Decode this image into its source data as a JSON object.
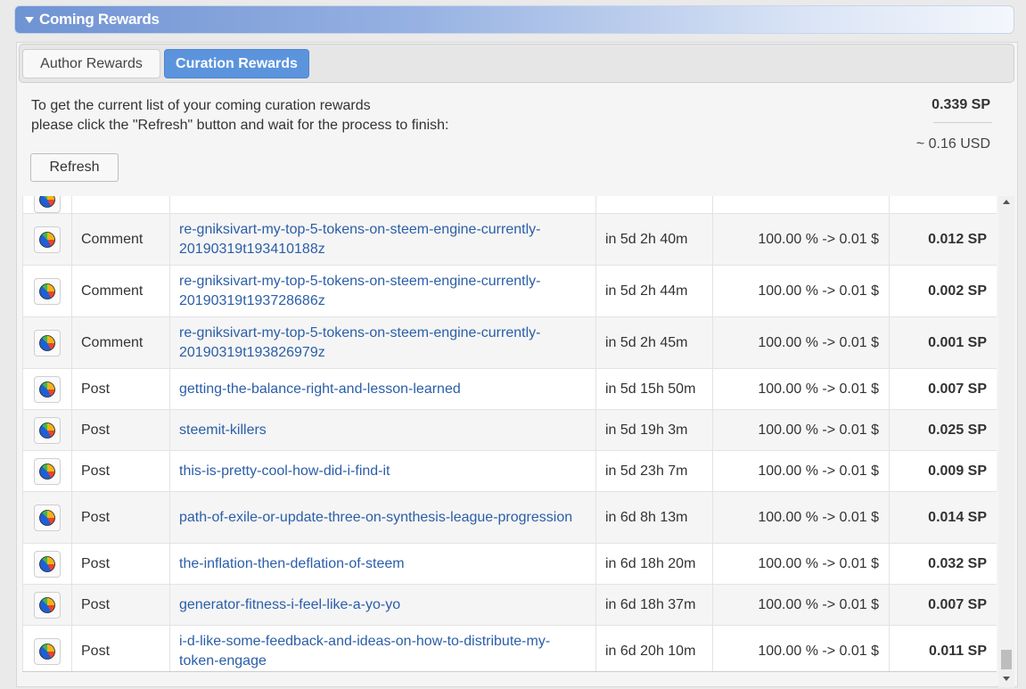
{
  "header": {
    "title": "Coming Rewards"
  },
  "tabs": {
    "author": "Author Rewards",
    "curation": "Curation Rewards"
  },
  "info": {
    "line1": "To get the current list of your coming curation rewards",
    "line2": "please click the \"Refresh\" button and wait for the process to finish:"
  },
  "totals": {
    "sp": "0.339 SP",
    "usd": "~ 0.16 USD"
  },
  "refresh_label": "Refresh",
  "icon_name": "pie-chart-icon",
  "colors": {
    "header_blue": "#6f93d3",
    "active_tab": "#5b94dd",
    "link": "#2b5ea8"
  },
  "rows": [
    {
      "type": "",
      "permlink": "",
      "time": "",
      "percent": "",
      "sp": ""
    },
    {
      "type": "Comment",
      "permlink": "re-gniksivart-my-top-5-tokens-on-steem-engine-currently-20190319t193410188z",
      "time": "in 5d 2h 40m",
      "percent": "100.00 %  ->  0.01 $",
      "sp": "0.012 SP"
    },
    {
      "type": "Comment",
      "permlink": "re-gniksivart-my-top-5-tokens-on-steem-engine-currently-20190319t193728686z",
      "time": "in 5d 2h 44m",
      "percent": "100.00 %  ->  0.01 $",
      "sp": "0.002 SP"
    },
    {
      "type": "Comment",
      "permlink": "re-gniksivart-my-top-5-tokens-on-steem-engine-currently-20190319t193826979z",
      "time": "in 5d 2h 45m",
      "percent": "100.00 %  ->  0.01 $",
      "sp": "0.001 SP"
    },
    {
      "type": "Post",
      "permlink": "getting-the-balance-right-and-lesson-learned",
      "time": "in 5d 15h 50m",
      "percent": "100.00 %  ->  0.01 $",
      "sp": "0.007 SP"
    },
    {
      "type": "Post",
      "permlink": "steemit-killers",
      "time": "in 5d 19h 3m",
      "percent": "100.00 %  ->  0.01 $",
      "sp": "0.025 SP"
    },
    {
      "type": "Post",
      "permlink": "this-is-pretty-cool-how-did-i-find-it",
      "time": "in 5d 23h 7m",
      "percent": "100.00 %  ->  0.01 $",
      "sp": "0.009 SP"
    },
    {
      "type": "Post",
      "permlink": "path-of-exile-or-update-three-on-synthesis-league-progression",
      "time": "in 6d 8h 13m",
      "percent": "100.00 %  ->  0.01 $",
      "sp": "0.014 SP"
    },
    {
      "type": "Post",
      "permlink": "the-inflation-then-deflation-of-steem",
      "time": "in 6d 18h 20m",
      "percent": "100.00 %  ->  0.01 $",
      "sp": "0.032 SP"
    },
    {
      "type": "Post",
      "permlink": "generator-fitness-i-feel-like-a-yo-yo",
      "time": "in 6d 18h 37m",
      "percent": "100.00 %  ->  0.01 $",
      "sp": "0.007 SP"
    },
    {
      "type": "Post",
      "permlink": "i-d-like-some-feedback-and-ideas-on-how-to-distribute-my-token-engage",
      "time": "in 6d 20h 10m",
      "percent": "100.00 %  ->  0.01 $",
      "sp": "0.011 SP"
    }
  ]
}
